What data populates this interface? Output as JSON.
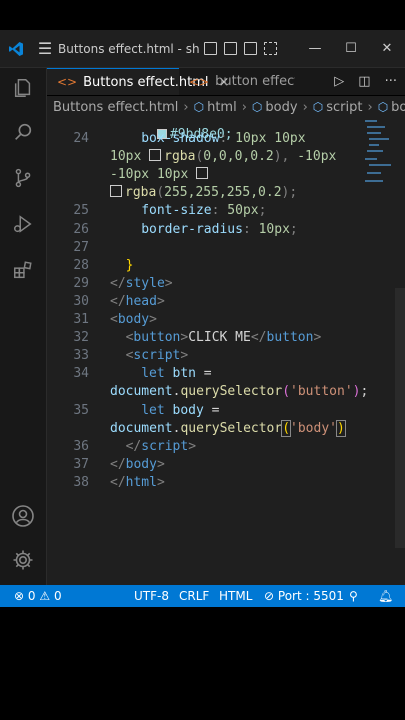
{
  "window": {
    "title": "Buttons effect.html - short...",
    "controls": {
      "minimize": "—",
      "maximize": "☐",
      "close": "✕"
    }
  },
  "tabs": [
    {
      "label": "Buttons effect.html",
      "active": true,
      "close": "×"
    },
    {
      "label": "button effects.html",
      "active": false
    }
  ],
  "breadcrumb": [
    "Buttons effect.html",
    "html",
    "body",
    "script",
    "body"
  ],
  "editor": {
    "top_partial": "#9bd8e0;",
    "lines": [
      {
        "n": "24",
        "segments": [
          [
            "prop",
            "box-shadow"
          ],
          [
            "punct",
            ": "
          ],
          [
            "num",
            "10px 10px"
          ]
        ]
      },
      {
        "n": "",
        "segments": [
          [
            "num",
            "10px "
          ],
          [
            "swatch",
            ""
          ],
          [
            "fn",
            "rgba"
          ],
          [
            "punct",
            "("
          ],
          [
            "num",
            "0,0,0,0.2"
          ],
          [
            "punct",
            "), "
          ],
          [
            "num",
            "-10px"
          ]
        ]
      },
      {
        "n": "",
        "segments": [
          [
            "num",
            "-10px 10px "
          ],
          [
            "swatch",
            ""
          ]
        ]
      },
      {
        "n": "",
        "segments": [
          [
            "swatch",
            ""
          ],
          [
            "fn",
            "rgba"
          ],
          [
            "punct",
            "("
          ],
          [
            "num",
            "255,255,255,0.2"
          ],
          [
            "punct",
            ");"
          ]
        ]
      },
      {
        "n": "25",
        "segments": [
          [
            "prop",
            "font-size"
          ],
          [
            "punct",
            ": "
          ],
          [
            "num",
            "50px"
          ],
          [
            "punct",
            ";"
          ]
        ]
      },
      {
        "n": "26",
        "segments": [
          [
            "prop",
            "border-radius"
          ],
          [
            "punct",
            ": "
          ],
          [
            "num",
            "10px"
          ],
          [
            "punct",
            ";"
          ]
        ]
      },
      {
        "n": "27",
        "segments": []
      },
      {
        "n": "28",
        "segments": [
          [
            "brk2",
            "}"
          ]
        ]
      },
      {
        "n": "29",
        "segments": [
          [
            "punct",
            "</"
          ],
          [
            "tag",
            "style"
          ],
          [
            "punct",
            ">"
          ]
        ]
      },
      {
        "n": "30",
        "segments": [
          [
            "punct",
            "</"
          ],
          [
            "tag",
            "head"
          ],
          [
            "punct",
            ">"
          ]
        ]
      },
      {
        "n": "31",
        "segments": [
          [
            "punct",
            "<"
          ],
          [
            "tag",
            "body"
          ],
          [
            "punct",
            ">"
          ]
        ]
      },
      {
        "n": "32",
        "segments": [
          [
            "punct",
            "<"
          ],
          [
            "tag",
            "button"
          ],
          [
            "punct",
            ">"
          ],
          [
            "text",
            "CLICK ME"
          ],
          [
            "punct",
            "</"
          ],
          [
            "tag",
            "button"
          ],
          [
            "punct",
            ">"
          ]
        ]
      },
      {
        "n": "33",
        "segments": [
          [
            "punct",
            "<"
          ],
          [
            "tag",
            "script"
          ],
          [
            "punct",
            ">"
          ]
        ]
      },
      {
        "n": "34",
        "segments": [
          [
            "kw",
            "let"
          ],
          [
            "text",
            " "
          ],
          [
            "var",
            "btn"
          ],
          [
            "text",
            " ="
          ]
        ]
      },
      {
        "n": "",
        "segments": [
          [
            "var",
            "document"
          ],
          [
            "text",
            "."
          ],
          [
            "fn",
            "querySelector"
          ],
          [
            "brk",
            "("
          ],
          [
            "str",
            "'button'"
          ],
          [
            "brk",
            ")"
          ],
          [
            "text",
            ";"
          ]
        ]
      },
      {
        "n": "35",
        "segments": [
          [
            "kw",
            "let"
          ],
          [
            "text",
            " "
          ],
          [
            "var",
            "body"
          ],
          [
            "text",
            " ="
          ]
        ]
      },
      {
        "n": "",
        "segments": [
          [
            "var",
            "document"
          ],
          [
            "text",
            "."
          ],
          [
            "fn",
            "querySelector"
          ],
          [
            "brkbox",
            "("
          ],
          [
            "str",
            "'body'"
          ],
          [
            "brkbox",
            ")"
          ]
        ]
      },
      {
        "n": "36",
        "segments": [
          [
            "punct",
            "</"
          ],
          [
            "tag",
            "script"
          ],
          [
            "punct",
            ">"
          ]
        ]
      },
      {
        "n": "37",
        "segments": [
          [
            "punct",
            "</"
          ],
          [
            "tag",
            "body"
          ],
          [
            "punct",
            ">"
          ]
        ]
      },
      {
        "n": "38",
        "segments": [
          [
            "punct",
            "</"
          ],
          [
            "tag",
            "html"
          ],
          [
            "punct",
            ">"
          ]
        ]
      }
    ]
  },
  "statusbar": {
    "errors": "0",
    "warnings": "0",
    "encoding": "UTF-8",
    "eol": "CRLF",
    "language": "HTML",
    "port": "Port : 5501"
  },
  "colors": {
    "accent": "#0078d4",
    "editor_bg": "#1f1f1f",
    "tag": "#569cd6",
    "number": "#b5cea8",
    "string": "#ce9178"
  }
}
